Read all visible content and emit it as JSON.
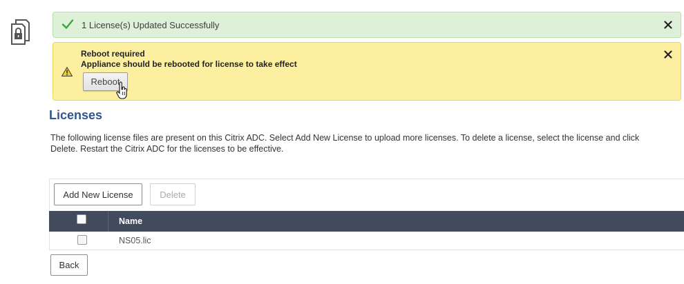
{
  "icons": {
    "page": "license-lock-icon",
    "success": "checkmark-icon",
    "warning": "warning-icon",
    "close": "close-icon",
    "cursor": "hand-pointer-icon"
  },
  "colors": {
    "heading": "#33548d",
    "success_bg": "#dff0d8",
    "success_check": "#3aa53a",
    "warning_bg": "#fcf0a0",
    "table_header_bg": "#424b5c"
  },
  "notifications": {
    "success": {
      "message": "1 License(s) Updated Successfully"
    },
    "warning": {
      "title": "Reboot required",
      "message": "Appliance should be rebooted for license to take effect",
      "button_label": "Reboot"
    }
  },
  "main": {
    "heading": "Licenses",
    "description": "The following license files are present on this Citrix ADC. Select Add New License to upload more licenses. To delete a license, select the license and click Delete. Restart the Citrix ADC for the licenses to be effective.",
    "toolbar": {
      "add_label": "Add New License",
      "delete_label": "Delete"
    },
    "table": {
      "columns": [
        "Name"
      ],
      "rows": [
        {
          "name": "NS05.lic",
          "selected": false
        }
      ]
    },
    "back_label": "Back"
  }
}
